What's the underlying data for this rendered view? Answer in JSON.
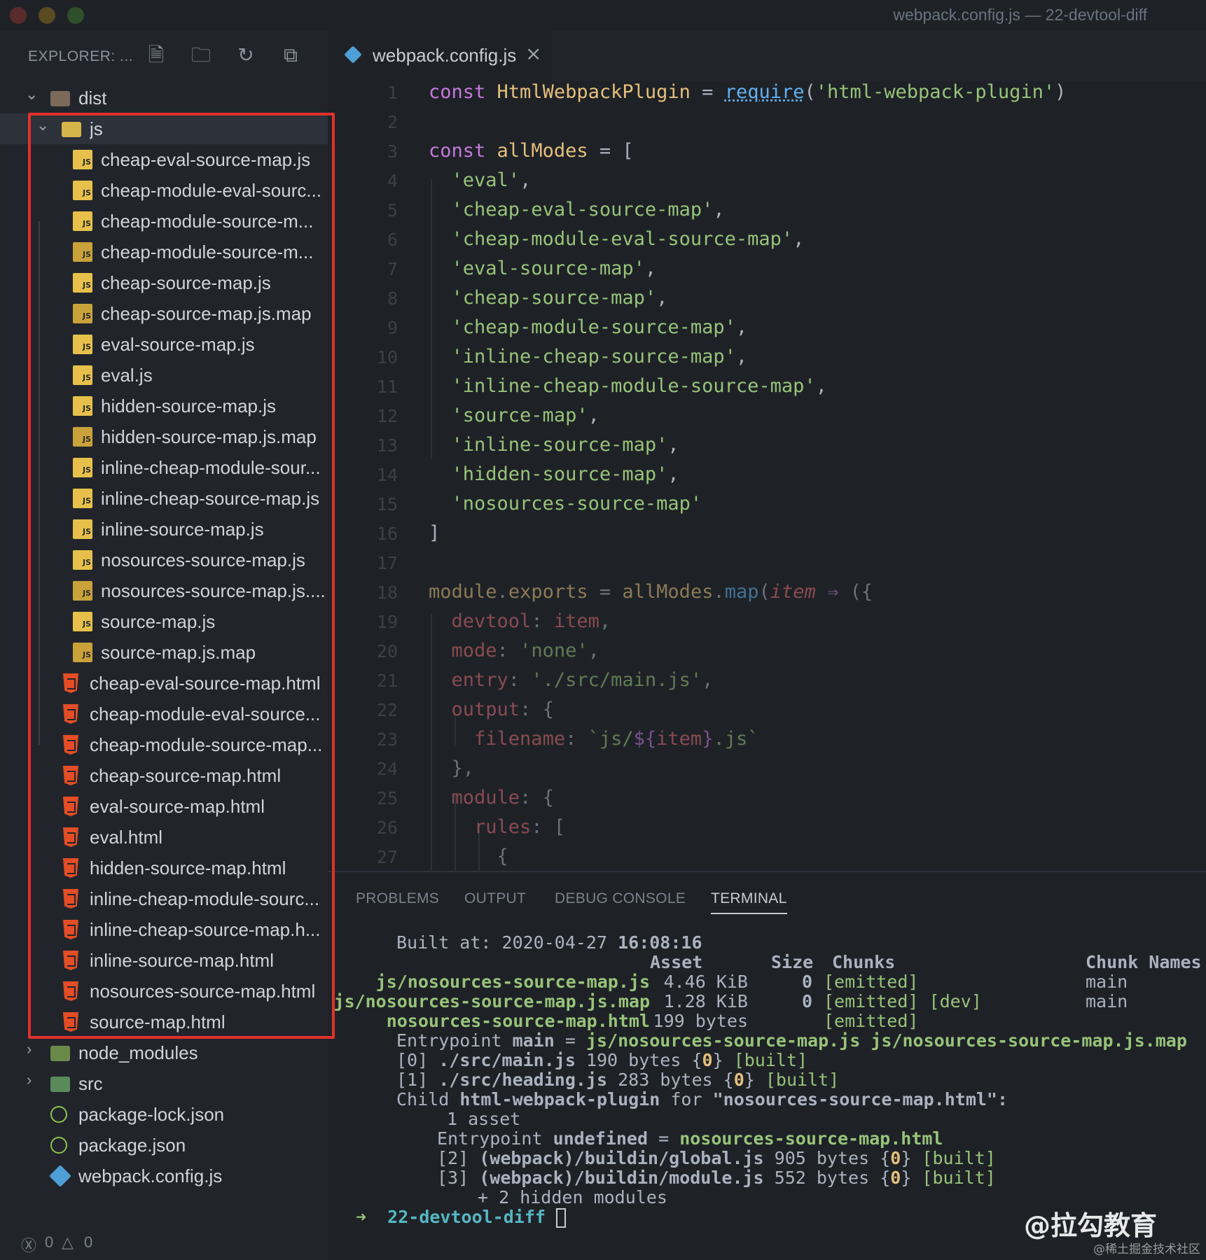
{
  "window": {
    "title": "webpack.config.js — 22-devtool-diff"
  },
  "explorer": {
    "title": "EXPLORER: ...",
    "icons": [
      "new-file-icon",
      "new-folder-icon",
      "refresh-icon",
      "collapse-all-icon"
    ]
  },
  "tree": {
    "dist": "dist",
    "js": "js",
    "js_files": [
      {
        "name": "cheap-eval-source-map.js",
        "type": "js"
      },
      {
        "name": "cheap-module-eval-sourc...",
        "type": "js"
      },
      {
        "name": "cheap-module-source-m...",
        "type": "js"
      },
      {
        "name": "cheap-module-source-m...",
        "type": "jsmap"
      },
      {
        "name": "cheap-source-map.js",
        "type": "js"
      },
      {
        "name": "cheap-source-map.js.map",
        "type": "jsmap"
      },
      {
        "name": "eval-source-map.js",
        "type": "js"
      },
      {
        "name": "eval.js",
        "type": "js"
      },
      {
        "name": "hidden-source-map.js",
        "type": "js"
      },
      {
        "name": "hidden-source-map.js.map",
        "type": "jsmap"
      },
      {
        "name": "inline-cheap-module-sour...",
        "type": "js"
      },
      {
        "name": "inline-cheap-source-map.js",
        "type": "js"
      },
      {
        "name": "inline-source-map.js",
        "type": "js"
      },
      {
        "name": "nosources-source-map.js",
        "type": "js"
      },
      {
        "name": "nosources-source-map.js....",
        "type": "jsmap"
      },
      {
        "name": "source-map.js",
        "type": "js"
      },
      {
        "name": "source-map.js.map",
        "type": "jsmap"
      }
    ],
    "html_files": [
      "cheap-eval-source-map.html",
      "cheap-module-eval-source...",
      "cheap-module-source-map...",
      "cheap-source-map.html",
      "eval-source-map.html",
      "eval.html",
      "hidden-source-map.html",
      "inline-cheap-module-sourc...",
      "inline-cheap-source-map.h...",
      "inline-source-map.html",
      "nosources-source-map.html",
      "source-map.html"
    ],
    "node_modules": "node_modules",
    "src": "src",
    "root_files": [
      "package-lock.json",
      "package.json",
      "webpack.config.js"
    ]
  },
  "status": {
    "errors": "0",
    "warnings": "0"
  },
  "tab": {
    "label": "webpack.config.js"
  },
  "code": {
    "line_numbers": [
      "1",
      "2",
      "3",
      "4",
      "5",
      "6",
      "7",
      "8",
      "9",
      "10",
      "11",
      "12",
      "13",
      "14",
      "15",
      "16",
      "17",
      "18",
      "19",
      "20",
      "21",
      "22",
      "23",
      "24",
      "25",
      "26",
      "27"
    ],
    "modes": [
      "'eval'",
      "'cheap-eval-source-map'",
      "'cheap-module-eval-source-map'",
      "'eval-source-map'",
      "'cheap-source-map'",
      "'cheap-module-source-map'",
      "'inline-cheap-source-map'",
      "'inline-cheap-module-source-map'",
      "'source-map'",
      "'inline-source-map'",
      "'hidden-source-map'",
      "'nosources-source-map'"
    ]
  },
  "panel": {
    "tabs": [
      "PROBLEMS",
      "OUTPUT",
      "DEBUG CONSOLE",
      "TERMINAL"
    ],
    "active_tab": "TERMINAL"
  },
  "terminal": {
    "built_at": "Built at: 2020-04-27",
    "built_time": "16:08:16",
    "headers": {
      "asset": "Asset",
      "size": "Size",
      "chunks": "Chunks",
      "chunk_names": "Chunk Names"
    },
    "assets": [
      {
        "asset": "js/nosources-source-map.js",
        "size": "4.46 KiB",
        "chunks": "0",
        "flags": "[emitted]",
        "names": "main"
      },
      {
        "asset": "js/nosources-source-map.js.map",
        "size": "1.28 KiB",
        "chunks": "0",
        "flags": "[emitted] [dev]",
        "names": "main"
      },
      {
        "asset": "nosources-source-map.html",
        "size": "199 bytes",
        "chunks": "",
        "flags": "[emitted]",
        "names": ""
      }
    ],
    "entrypoint_label": "Entrypoint",
    "entrypoint_name": "main",
    "entrypoint_files": "js/nosources-source-map.js js/nosources-source-map.js.map",
    "modules": [
      {
        "id": "[0]",
        "path": "./src/main.js",
        "size": "190 bytes",
        "chunk": "0",
        "flag": "[built]"
      },
      {
        "id": "[1]",
        "path": "./src/heading.js",
        "size": "283 bytes",
        "chunk": "0",
        "flag": "[built]"
      }
    ],
    "child_label": "Child",
    "child_name": "html-webpack-plugin",
    "child_for": "for",
    "child_target": "\"nosources-source-map.html\":",
    "child_assets": "1 asset",
    "child_entry_label": "Entrypoint",
    "child_entry_name": "undefined",
    "child_entry_file": "nosources-source-map.html",
    "child_modules": [
      {
        "id": "[2]",
        "path": "(webpack)/buildin/global.js",
        "size": "905 bytes",
        "chunk": "0",
        "flag": "[built]"
      },
      {
        "id": "[3]",
        "path": "(webpack)/buildin/module.js",
        "size": "552 bytes",
        "chunk": "0",
        "flag": "[built]"
      }
    ],
    "hidden": "+ 2 hidden modules",
    "prompt_dir": "22-devtool-diff"
  },
  "watermark": {
    "main": "@拉勾教育",
    "sub": "@稀土掘金技术社区"
  }
}
